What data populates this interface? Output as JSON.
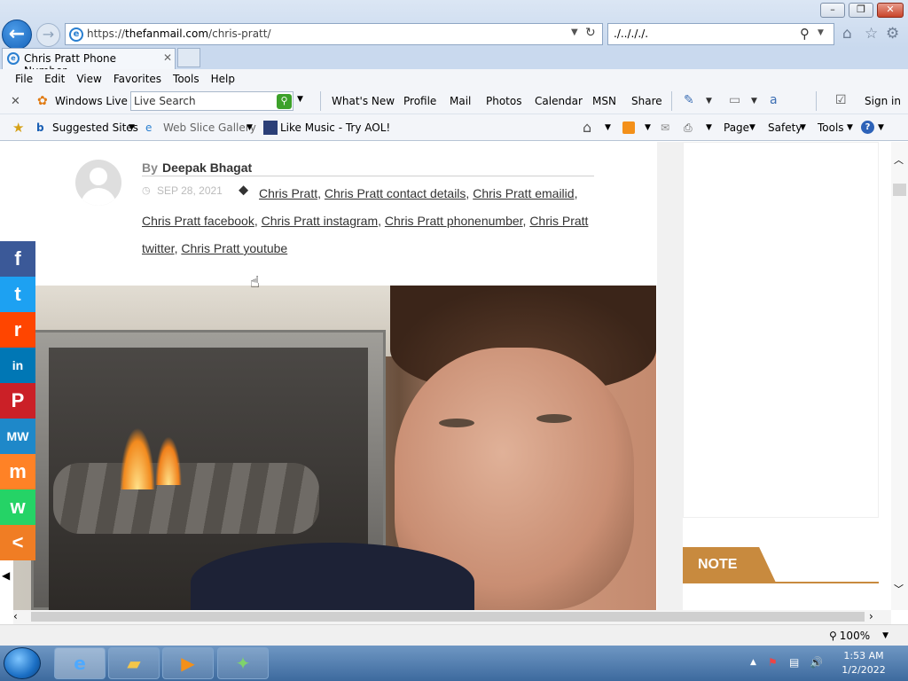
{
  "browser": {
    "url_scheme": "https://",
    "url_host": "thefanmail.com",
    "url_path": "/chris-pratt/",
    "search_value": "./../././.",
    "tab_title": "Chris Pratt Phone Number,..."
  },
  "menu": [
    "File",
    "Edit",
    "View",
    "Favorites",
    "Tools",
    "Help"
  ],
  "livebar": {
    "windows_live": "Windows Live",
    "search_placeholder": "Live Search",
    "links": [
      "What's New",
      "Profile",
      "Mail",
      "Photos",
      "Calendar",
      "MSN",
      "Share"
    ],
    "sign_in": "Sign in"
  },
  "favbar": {
    "suggested": "Suggested Sites",
    "web_slice": "Web Slice Gallery",
    "like_music": "Like Music - Try AOL!",
    "page": "Page",
    "safety": "Safety",
    "tools": "Tools"
  },
  "article": {
    "by": "By",
    "author": "Deepak Bhagat",
    "date": "SEP 28, 2021",
    "tags": [
      "Chris Pratt",
      "Chris Pratt contact details",
      "Chris Pratt emailid",
      "Chris Pratt facebook",
      "Chris Pratt instagram",
      "Chris Pratt phonenumber",
      "Chris Pratt twitter",
      "Chris Pratt youtube"
    ]
  },
  "share": [
    {
      "name": "facebook",
      "glyph": "f",
      "color": "#3b5998"
    },
    {
      "name": "twitter",
      "glyph": "t",
      "color": "#1da1f2"
    },
    {
      "name": "reddit",
      "glyph": "r",
      "color": "#ff4500"
    },
    {
      "name": "linkedin",
      "glyph": "in",
      "color": "#0077b5"
    },
    {
      "name": "pinterest",
      "glyph": "P",
      "color": "#cb2027"
    },
    {
      "name": "mewe",
      "glyph": "MW",
      "color": "#1e88c9"
    },
    {
      "name": "mix",
      "glyph": "m",
      "color": "#ff8226"
    },
    {
      "name": "whatsapp",
      "glyph": "w",
      "color": "#25d366"
    },
    {
      "name": "share",
      "glyph": "<",
      "color": "#f07d24"
    }
  ],
  "sidebar": {
    "note_label": "NOTE"
  },
  "status": {
    "zoom": "100%"
  },
  "taskbar": {
    "time": "1:53 AM",
    "date": "1/2/2022"
  }
}
